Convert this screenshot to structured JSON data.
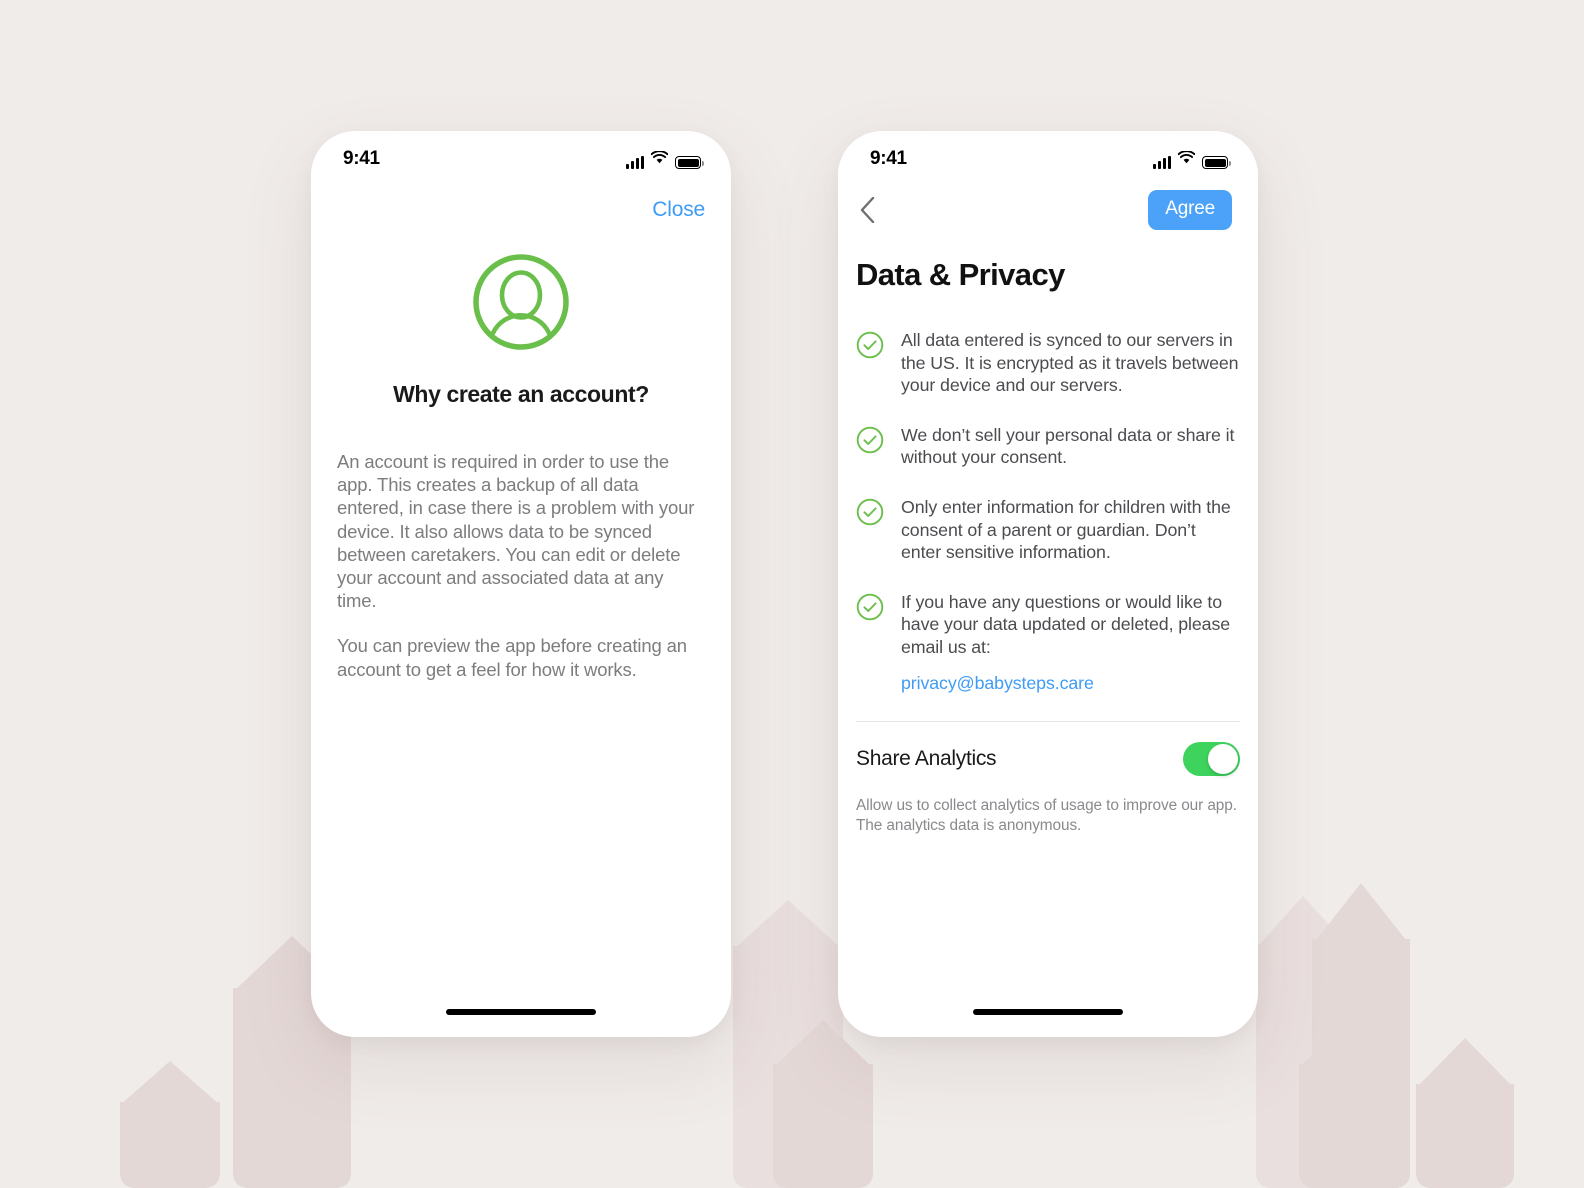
{
  "background": {
    "base_color": "#f0ecea",
    "house_color": "#e4d8d7",
    "house_color_light": "#e9dfde"
  },
  "colors": {
    "accent_blue": "#3f9bf7",
    "button_blue": "#4ba2f8",
    "accent_green": "#6abf4b",
    "toggle_green": "#3dd35c",
    "body_text": "#7d7d80"
  },
  "screens": [
    {
      "id": "why-create-an-account",
      "status_bar": {
        "time": "9:41",
        "icons": [
          "cellular-signal-icon",
          "wifi-icon",
          "battery-icon"
        ]
      },
      "nav": {
        "close_label": "Close"
      },
      "avatar_icon": "person-circle-icon",
      "title": "Why create an account?",
      "paragraphs": [
        "An account is required in order to use the app. This creates a backup of all data entered, in case there is a problem with your device. It also allows data to be synced between caretakers. You can edit or delete your account and associated data at any time.",
        "You can preview the app before creating an account to get a feel for how it works."
      ],
      "home_indicator": true
    },
    {
      "id": "data-and-privacy",
      "status_bar": {
        "time": "9:41",
        "icons": [
          "cellular-signal-icon",
          "wifi-icon",
          "battery-icon"
        ]
      },
      "nav": {
        "back_icon": "chevron-left-icon",
        "agree_label": "Agree"
      },
      "title": "Data & Privacy",
      "bullets": [
        {
          "icon": "check-circle-icon",
          "text": "All data entered is synced to our servers in the US. It is encrypted as it travels between your device and our servers."
        },
        {
          "icon": "check-circle-icon",
          "text": "We don’t sell your personal data or share it without your consent."
        },
        {
          "icon": "check-circle-icon",
          "text": "Only enter information for children with the consent of a parent or guardian. Don’t enter sensitive information."
        },
        {
          "icon": "check-circle-icon",
          "text": "If you have any questions or would like to have your data updated or deleted, please email us at:",
          "email": "privacy@babysteps.care"
        }
      ],
      "analytics": {
        "label": "Share Analytics",
        "toggle_on": true,
        "help_text": "Allow us to collect analytics of usage to improve our app. The analytics data is anonymous."
      },
      "home_indicator": true
    }
  ]
}
